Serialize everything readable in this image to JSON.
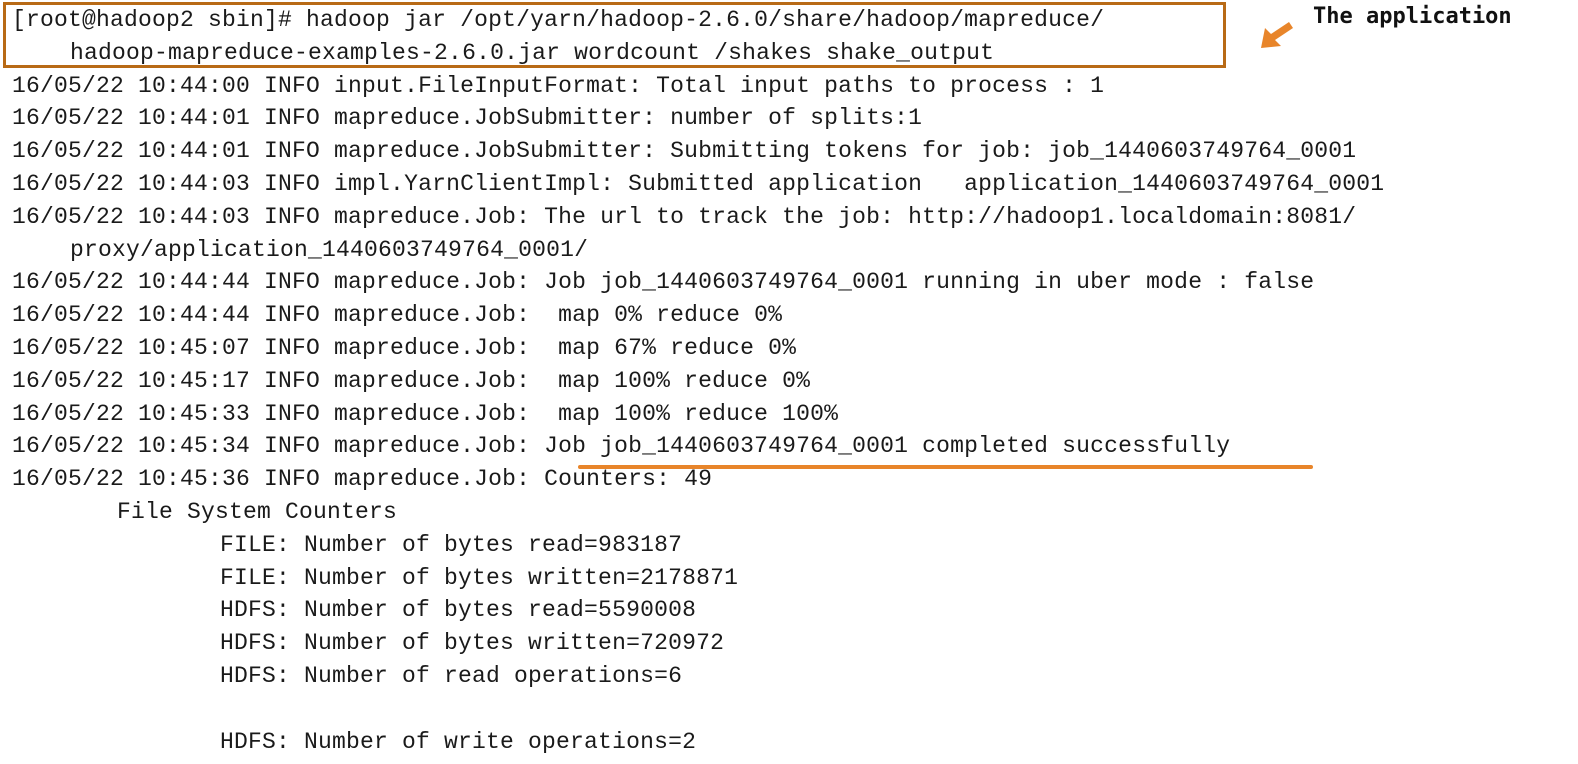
{
  "terminal": {
    "command": {
      "line1": "[root@hadoop2 sbin]# hadoop jar /opt/yarn/hadoop-2.6.0/share/hadoop/mapreduce/",
      "line2": "hadoop-mapreduce-examples-2.6.0.jar wordcount /shakes shake_output"
    },
    "log": {
      "l01": "16/05/22 10:44:00 INFO input.FileInputFormat: Total input paths to process : 1",
      "l02": "16/05/22 10:44:01 INFO mapreduce.JobSubmitter: number of splits:1",
      "l03": "16/05/22 10:44:01 INFO mapreduce.JobSubmitter: Submitting tokens for job: job_1440603749764_0001",
      "l04": "16/05/22 10:44:03 INFO impl.YarnClientImpl: Submitted application   application_1440603749764_0001",
      "l05": "16/05/22 10:44:03 INFO mapreduce.Job: The url to track the job: http://hadoop1.localdomain:8081/",
      "l05b": "proxy/application_1440603749764_0001/",
      "l06": "16/05/22 10:44:44 INFO mapreduce.Job: Job job_1440603749764_0001 running in uber mode : false",
      "l07": "16/05/22 10:44:44 INFO mapreduce.Job:  map 0% reduce 0%",
      "l08": "16/05/22 10:45:07 INFO mapreduce.Job:  map 67% reduce 0%",
      "l09": "16/05/22 10:45:17 INFO mapreduce.Job:  map 100% reduce 0%",
      "l10": "16/05/22 10:45:33 INFO mapreduce.Job:  map 100% reduce 100%",
      "l11_prefix": "16/05/22 10:45:34 INFO mapreduce.Job: ",
      "l11_status": "Job job_1440603749764_0001 completed successfully",
      "l12": "16/05/22 10:45:36 INFO mapreduce.Job: Counters: 49"
    },
    "counters": {
      "group": "File System Counters",
      "c1": "FILE: Number of bytes read=983187",
      "c2": "FILE: Number of bytes written=2178871",
      "c3": "HDFS: Number of bytes read=5590008",
      "c4": "HDFS: Number of bytes written=720972",
      "c5": "HDFS: Number of read operations=6",
      "c6": "HDFS: Number of write operations=2"
    }
  },
  "annotation": {
    "callout": "The application",
    "box_color": "#b86a16",
    "arrow_color": "#e8852a",
    "underline_color": "#e8852a",
    "arrow_icon": "arrow-left-down-icon"
  }
}
